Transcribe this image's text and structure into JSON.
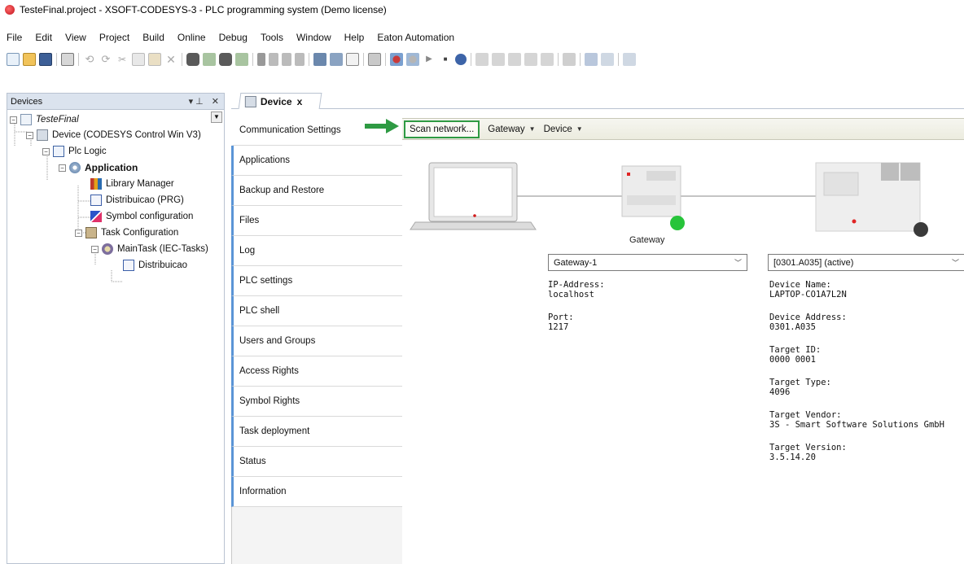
{
  "window": {
    "title": "TesteFinal.project - XSOFT-CODESYS-3 - PLC programming system (Demo license)"
  },
  "menu": [
    "File",
    "Edit",
    "View",
    "Project",
    "Build",
    "Online",
    "Debug",
    "Tools",
    "Window",
    "Help",
    "Eaton Automation"
  ],
  "devices_panel": {
    "title": "Devices",
    "pin_glyph": "▾ ⊥",
    "close_glyph": "✕",
    "tree": [
      {
        "label": "TesteFinal",
        "italic": true,
        "icon": "project-icon"
      },
      {
        "label": "Device (CODESYS Control Win V3)",
        "icon": "device-icon"
      },
      {
        "label": "Plc Logic",
        "icon": "plc-logic-icon"
      },
      {
        "label": "Application",
        "bold": true,
        "icon": "application-gear-icon"
      },
      {
        "label": "Library Manager",
        "icon": "library-icon"
      },
      {
        "label": "Distribuicao (PRG)",
        "icon": "program-icon"
      },
      {
        "label": "Symbol configuration",
        "icon": "symbol-config-icon"
      },
      {
        "label": "Task Configuration",
        "icon": "task-config-icon"
      },
      {
        "label": "MainTask (IEC-Tasks)",
        "icon": "task-icon"
      },
      {
        "label": "Distribuicao",
        "icon": "program-call-icon"
      }
    ]
  },
  "document": {
    "tab_label": "Device",
    "tab_close": "x"
  },
  "side_tabs": [
    "Communication Settings",
    "Applications",
    "Backup and Restore",
    "Files",
    "Log",
    "PLC settings",
    "PLC shell",
    "Users and Groups",
    "Access Rights",
    "Symbol Rights",
    "Task deployment",
    "Status",
    "Information"
  ],
  "content_toolbar": {
    "scan_label": "Scan network...",
    "gateway_label": "Gateway",
    "device_label": "Device"
  },
  "gateway": {
    "caption": "Gateway",
    "selected": "Gateway-1",
    "fields": [
      {
        "label": "IP-Address:",
        "value": "localhost"
      },
      {
        "label": "Port:",
        "value": "1217"
      }
    ],
    "status_color": "#27c43a"
  },
  "device": {
    "selected": "[0301.A035] (active)",
    "fields": [
      {
        "label": "Device Name:",
        "value": "LAPTOP-CO1A7L2N"
      },
      {
        "label": "Device Address:",
        "value": "0301.A035"
      },
      {
        "label": "Target ID:",
        "value": "0000 0001"
      },
      {
        "label": "Target Type:",
        "value": "4096"
      },
      {
        "label": "Target Vendor:",
        "value": "3S - Smart Software Solutions GmbH"
      },
      {
        "label": "Target Version:",
        "value": "3.5.14.20"
      }
    ],
    "status_color": "#3a3a3a"
  },
  "colors": {
    "highlight_green": "#2e9a43",
    "tab_blue": "#5b95d6"
  }
}
